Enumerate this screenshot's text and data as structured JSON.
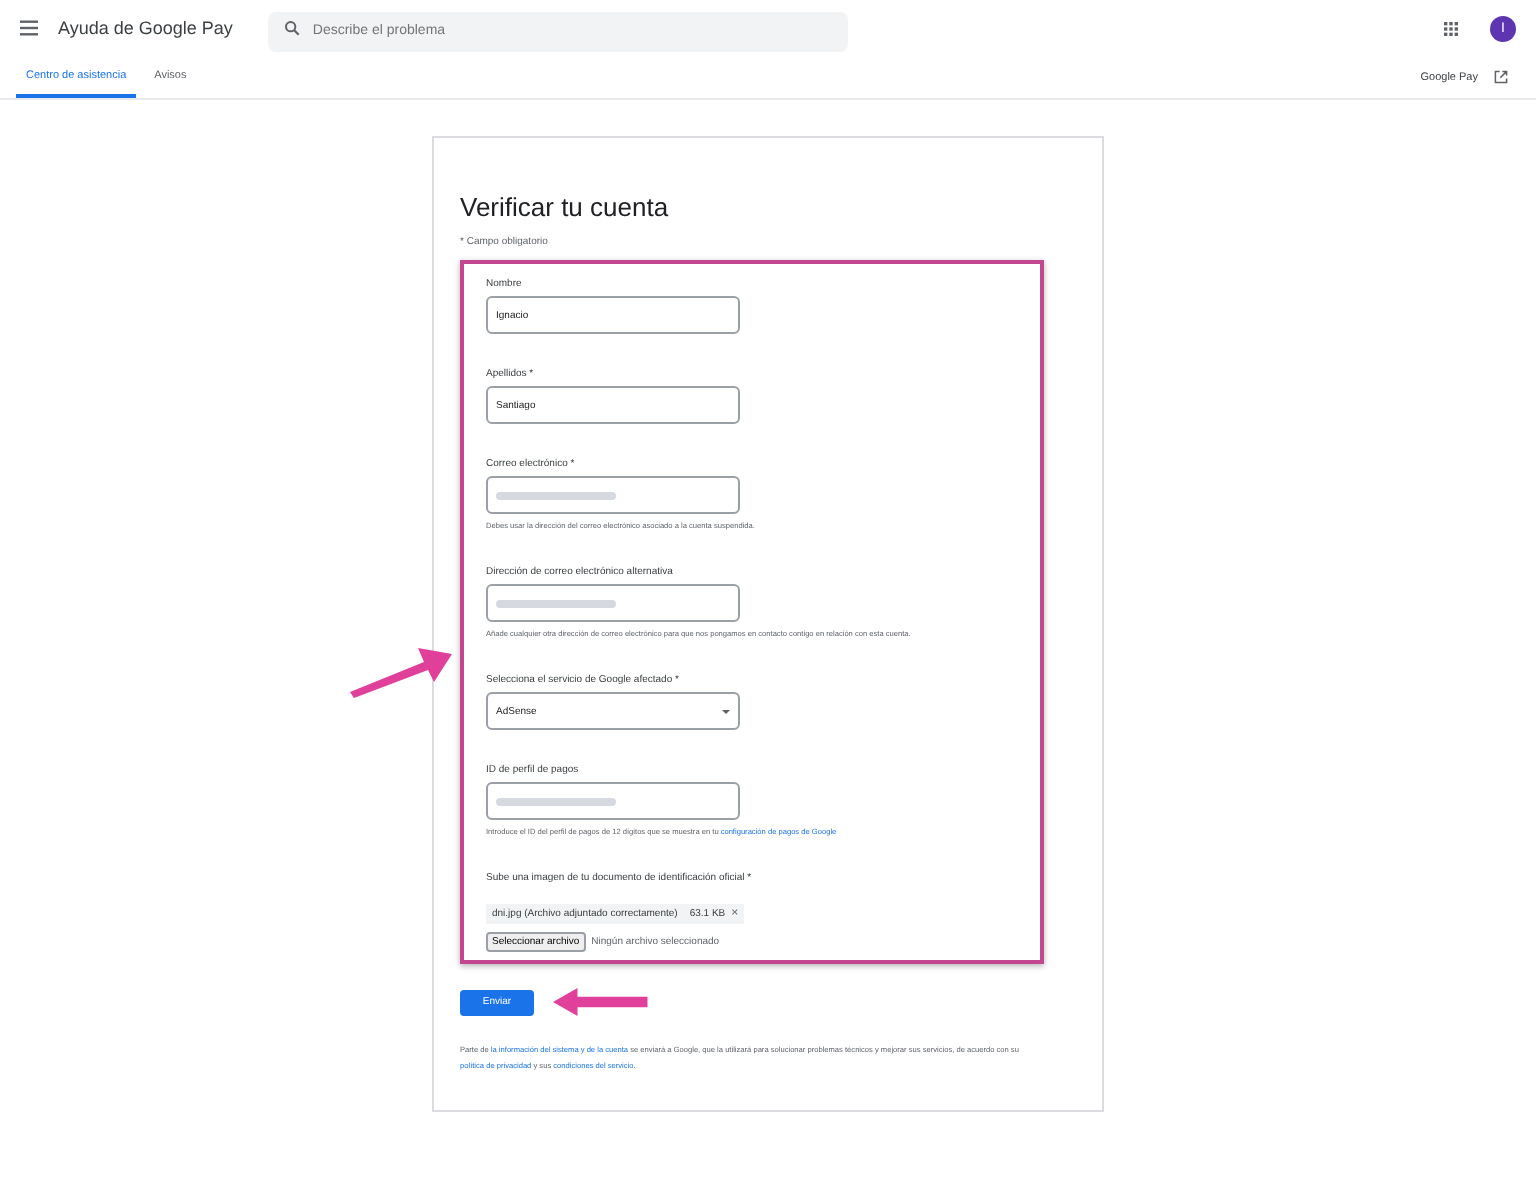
{
  "header": {
    "title": "Ayuda de Google Pay",
    "search": {
      "placeholder": "Describe el problema"
    },
    "avatar": "I"
  },
  "tabs": [
    {
      "label": "Centro de asistencia",
      "selected": true
    },
    {
      "label": "Avisos",
      "selected": false
    }
  ],
  "product_link": "Google Pay",
  "form": {
    "title": "Verificar tu cuenta",
    "required_note": "* Campo obligatorio",
    "fields": [
      {
        "kind": "text",
        "label": "Nombre",
        "value": "Ignacio"
      },
      {
        "kind": "text",
        "label": "Apellidos *",
        "value": "Santiago"
      },
      {
        "kind": "redacted",
        "label": "Correo electrónico *",
        "help": "Debes usar la dirección del correo electrónico asociado a la cuenta suspendida."
      },
      {
        "kind": "redacted",
        "label": "Dirección de correo electrónico alternativa",
        "help": "Añade cualquier otra dirección de correo electrónico para que nos pongamos en contacto contigo en relación con esta cuenta."
      },
      {
        "kind": "select",
        "label": "Selecciona el servicio de Google afectado *",
        "value": "AdSense"
      },
      {
        "kind": "redacted",
        "label": "ID de perfil de pagos",
        "help": "Introduce el ID del perfil de pagos de 12 dígitos que se muestra en tu",
        "help_link": "configuración de pagos de Google"
      },
      {
        "kind": "file",
        "label": "Sube una imagen de tu documento de identificación oficial *",
        "file_name": "dni.jpg (Archivo adjuntado correctamente)",
        "file_size": "63.1 KB",
        "remove": "×",
        "choose": "Seleccionar archivo",
        "no_file": "Ningún archivo seleccionado"
      }
    ],
    "submit": "Enviar",
    "disclaimer": [
      {
        "text": "Parte de "
      },
      {
        "link": "la información del sistema y de la cuenta"
      },
      {
        "text": " se enviará a Google, que la utilizará para solucionar problemas técnicos y mejorar sus servicios, de acuerdo con su "
      },
      {
        "link": "política de privacidad"
      },
      {
        "text": " y sus "
      },
      {
        "link": "condiciones del servicio"
      },
      {
        "text": "."
      }
    ]
  }
}
